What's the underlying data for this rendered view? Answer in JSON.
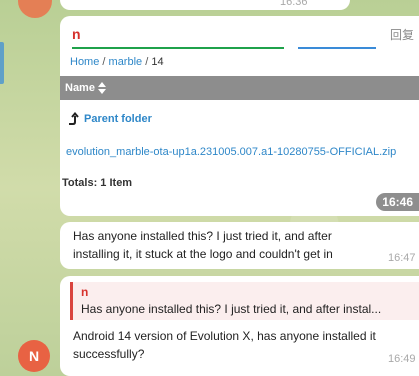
{
  "top": {
    "time": "16:36"
  },
  "message1": {
    "input_text": "n",
    "reply_label": "回复",
    "breadcrumb": {
      "home": "Home",
      "folder": "marble",
      "current": "14",
      "separator": "/"
    },
    "table_header": "Name",
    "parent_folder": "Parent folder",
    "file_name": "evolution_marble-ota-up1a.231005.007.a1-10280755-OFFICIAL.zip",
    "totals": "Totals: 1 Item",
    "time": "16:46"
  },
  "message2": {
    "text": "Has anyone installed this? I just tried it, and after installing it, it stuck at the logo and couldn't get in",
    "time": "16:47"
  },
  "message3": {
    "quote_author": "n",
    "quote_text": "Has anyone installed this? I just tried it, and after instal...",
    "text": "Android 14 version of Evolution X, has anyone installed it successfully?",
    "time": "16:49"
  },
  "sender_avatar": {
    "initial": "N"
  },
  "colors": {
    "accent_red": "#d6322d",
    "link_blue": "#2e87c8",
    "header_gray": "#8d8d8d",
    "avatar_orange": "#e86243"
  }
}
